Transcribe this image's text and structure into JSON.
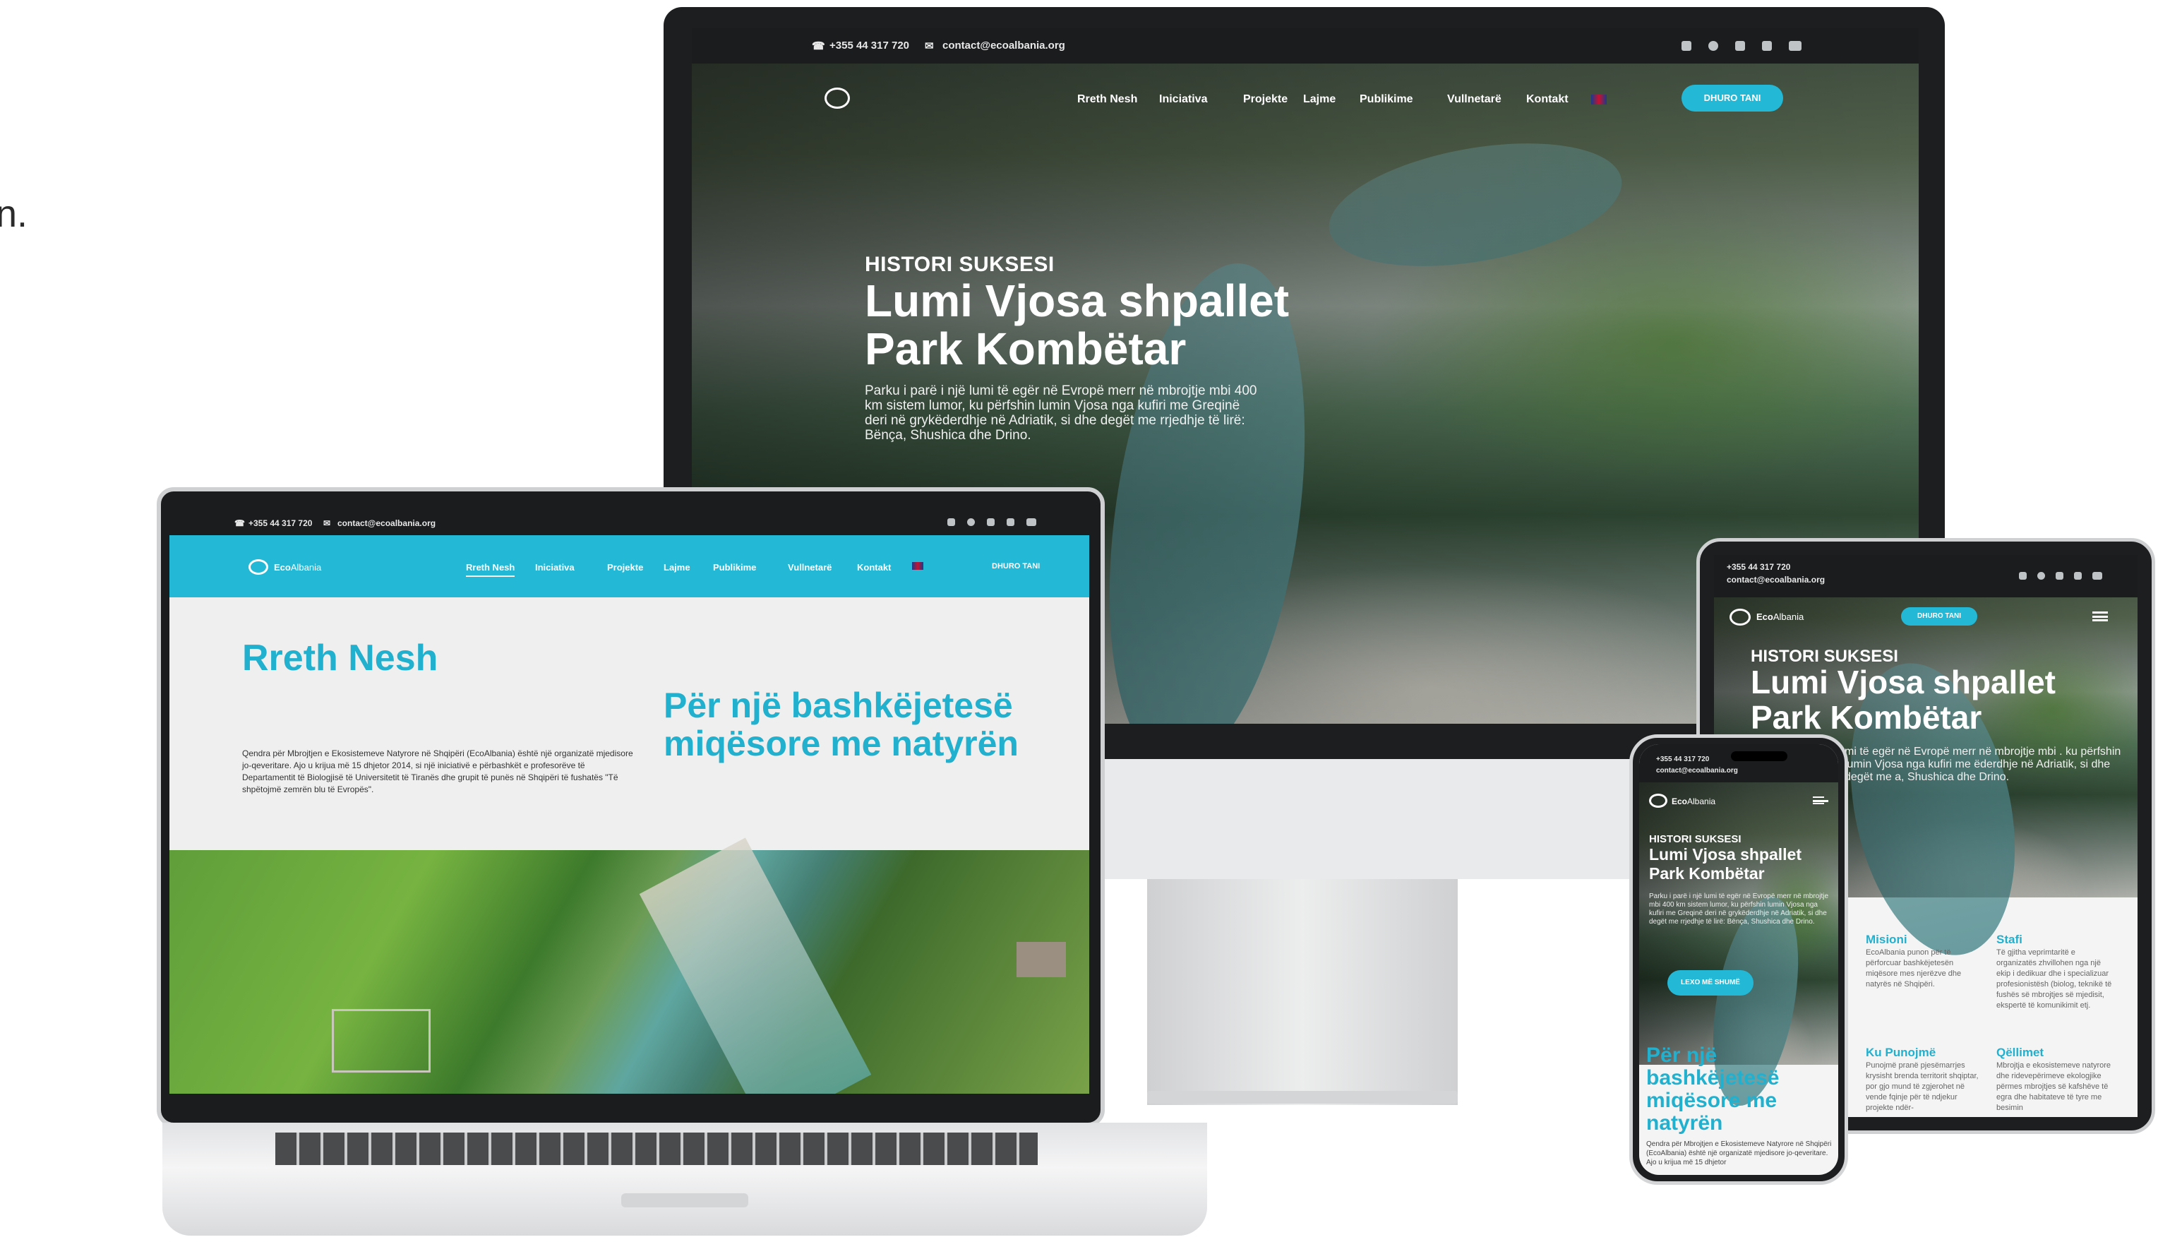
{
  "site": {
    "phone": "+355 44 317 720",
    "email": "contact@ecoalbania.org",
    "brand_eco": "Eco",
    "brand_albania": "Albania",
    "nav": [
      "Rreth Nesh",
      "Iniciativa",
      "Projekte",
      "Lajme",
      "Publikime",
      "Vullnetarë",
      "Kontakt"
    ],
    "donate_label": "DHURO TANI",
    "social_icons": [
      "instagram-icon",
      "facebook-icon",
      "twitter-icon",
      "linkedin-icon",
      "youtube-icon"
    ],
    "accent_color": "#22b8d6"
  },
  "cut_text": "n.",
  "hero": {
    "kicker": "HISTORI SUKSESI",
    "title_line1": "Lumi Vjosa shpallet",
    "title_line2": "Park Kombëtar",
    "title_mobile": "Lumi Vjosa shpallet Park Kombëtar",
    "description": "Parku i parë i një lumi të egër në Evropë merr në mbrojtje mbi 400 km sistem lumor, ku përfshin lumin Vjosa nga kufiri me Greqinë deri në grykëderdhje në Adriatik, si dhe degët me rrjedhje të lirë: Bënça, Shushica dhe Drino.",
    "description_tablet": "mi të egër në Evropë merr në mbrojtje mbi . ku përfshin lumin Vjosa nga kufiri me ëderdhje në Adriatik, si dhe degët me a, Shushica dhe Drino.",
    "read_more": "LEXO MË SHUMË"
  },
  "about": {
    "title": "Rreth Nesh",
    "tagline": "Për një bashkëjetesë miqësore me natyrën",
    "body": "Qendra për Mbrojtjen e Ekosistemeve Natyrore në Shqipëri (EcoAlbania) është një organizatë mjedisore jo-qeveritare. Ajo u krijua më 15 dhjetor 2014, si një iniciativë e përbashkët e profesorëve të Departamentit të Biologjisë të Universitetit të Tiranës dhe grupit të punës në Shqipëri të fushatës \"Të shpëtojmë zemrën blu të Evropës\".",
    "body_mobile": "Qendra për Mbrojtjen e Ekosistemeve Natyrore në Shqipëri (EcoAlbania) është një organizatë mjedisore jo-qeveritare. Ajo u krijua më 15 dhjetor"
  },
  "tablet_sections": [
    {
      "heading": "Misioni",
      "text": "EcoAlbania punon për të përforcuar bashkëjetesën miqësore mes njerëzve dhe natyrës në Shqipëri."
    },
    {
      "heading": "Stafi",
      "text": "Të gjitha veprimtaritë e organizatës zhvillohen nga një ekip i dedikuar dhe i specializuar profesionistësh (biolog, teknikë të fushës së mbrojtjes së mjedisit, ekspertë të komunikimit etj."
    },
    {
      "heading": "Ku Punojmë",
      "text": "Punojmë pranë pjesëmarrjes krysisht brenda territorit shqiptar, por gjo mund të zgjerohet në vende fqinje për të ndjekur projekte ndër-"
    },
    {
      "heading": "Qëllimet",
      "text": "Mbrojtja e ekosistemeve natyrore dhe ridevepërimeve ekologjike përmes mbrojtjes së kafshëve të egra dhe habitateve të tyre me besimin"
    }
  ]
}
